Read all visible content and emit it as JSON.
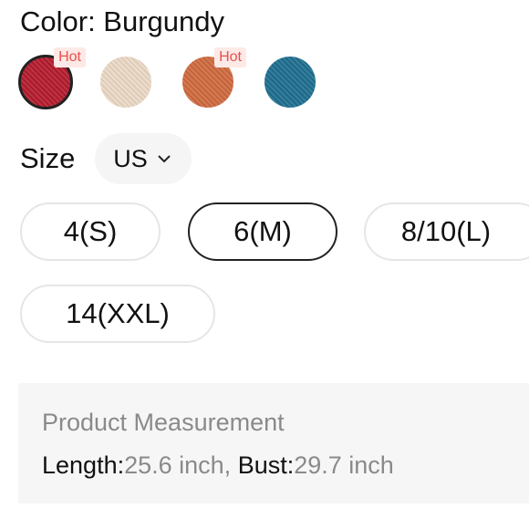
{
  "color": {
    "label": "Color: Burgundy",
    "swatches": [
      {
        "name": "burgundy",
        "color": "#b51c2e",
        "badge": "Hot",
        "selected": true
      },
      {
        "name": "beige",
        "color": "#ecd9c6",
        "badge": "",
        "selected": false
      },
      {
        "name": "rust-orange",
        "color": "#cf6a3f",
        "badge": "Hot",
        "selected": false
      },
      {
        "name": "teal-blue",
        "color": "#1f6f90",
        "badge": "",
        "selected": false
      }
    ]
  },
  "size": {
    "label": "Size",
    "unit": "US",
    "options": [
      "4(S)",
      "6(M)",
      "8/10(L)",
      "14(XXL)"
    ],
    "selected": "6(M)"
  },
  "measurement": {
    "title": "Product Measurement",
    "length_label": "Length:",
    "length_value": "25.6 inch, ",
    "bust_label": "Bust:",
    "bust_value": "29.7 inch"
  },
  "colors": {
    "hot_badge_bg": "#fde9e6",
    "hot_badge_text": "#e8504a",
    "selected_border": "#222222"
  }
}
